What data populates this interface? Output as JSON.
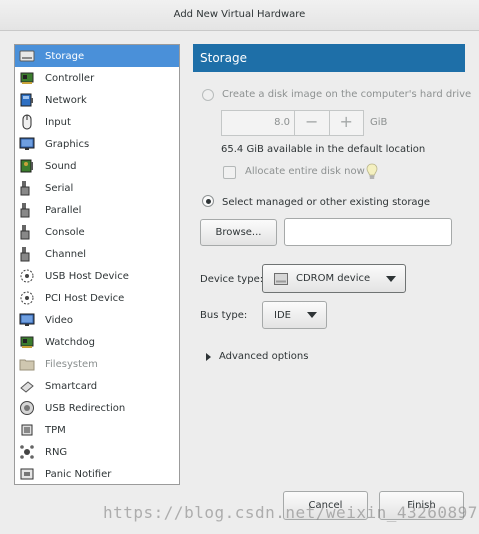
{
  "window": {
    "title": "Add New Virtual Hardware"
  },
  "sidebar": {
    "items": [
      {
        "label": "Storage",
        "icon": "disk-icon",
        "selected": true
      },
      {
        "label": "Controller",
        "icon": "controller-chip-icon"
      },
      {
        "label": "Network",
        "icon": "network-card-icon"
      },
      {
        "label": "Input",
        "icon": "mouse-icon"
      },
      {
        "label": "Graphics",
        "icon": "monitor-icon"
      },
      {
        "label": "Sound",
        "icon": "sound-card-icon"
      },
      {
        "label": "Serial",
        "icon": "serial-plug-icon"
      },
      {
        "label": "Parallel",
        "icon": "parallel-plug-icon"
      },
      {
        "label": "Console",
        "icon": "console-plug-icon"
      },
      {
        "label": "Channel",
        "icon": "channel-plug-icon"
      },
      {
        "label": "USB Host Device",
        "icon": "usb-icon"
      },
      {
        "label": "PCI Host Device",
        "icon": "pci-icon"
      },
      {
        "label": "Video",
        "icon": "monitor-icon"
      },
      {
        "label": "Watchdog",
        "icon": "watchdog-chip-icon"
      },
      {
        "label": "Filesystem",
        "icon": "folder-icon",
        "disabled": true
      },
      {
        "label": "Smartcard",
        "icon": "smartcard-icon"
      },
      {
        "label": "USB Redirection",
        "icon": "usb-redirection-icon"
      },
      {
        "label": "TPM",
        "icon": "tpm-chip-icon"
      },
      {
        "label": "RNG",
        "icon": "rng-icon"
      },
      {
        "label": "Panic Notifier",
        "icon": "panic-notifier-icon"
      }
    ]
  },
  "panel": {
    "title": "Storage",
    "create_disk_label": "Create a disk image on the computer's hard drive",
    "size_value": "8.0",
    "size_unit": "GiB",
    "available_text": "65.4 GiB available in the default location",
    "allocate_label": "Allocate entire disk now",
    "select_storage_label": "Select managed or other existing storage",
    "browse_label": "Browse...",
    "storage_path_value": "",
    "device_type_label": "Device type:",
    "device_type_value": "CDROM device",
    "bus_type_label": "Bus type:",
    "bus_type_value": "IDE",
    "advanced_label": "Advanced options"
  },
  "footer": {
    "cancel_label": "Cancel",
    "finish_label": "Finish"
  },
  "watermark": {
    "text": "https://blog.csdn.net/weixin_43260897"
  },
  "colors": {
    "accent": "#4a90d9",
    "header": "#1e6fa8"
  }
}
